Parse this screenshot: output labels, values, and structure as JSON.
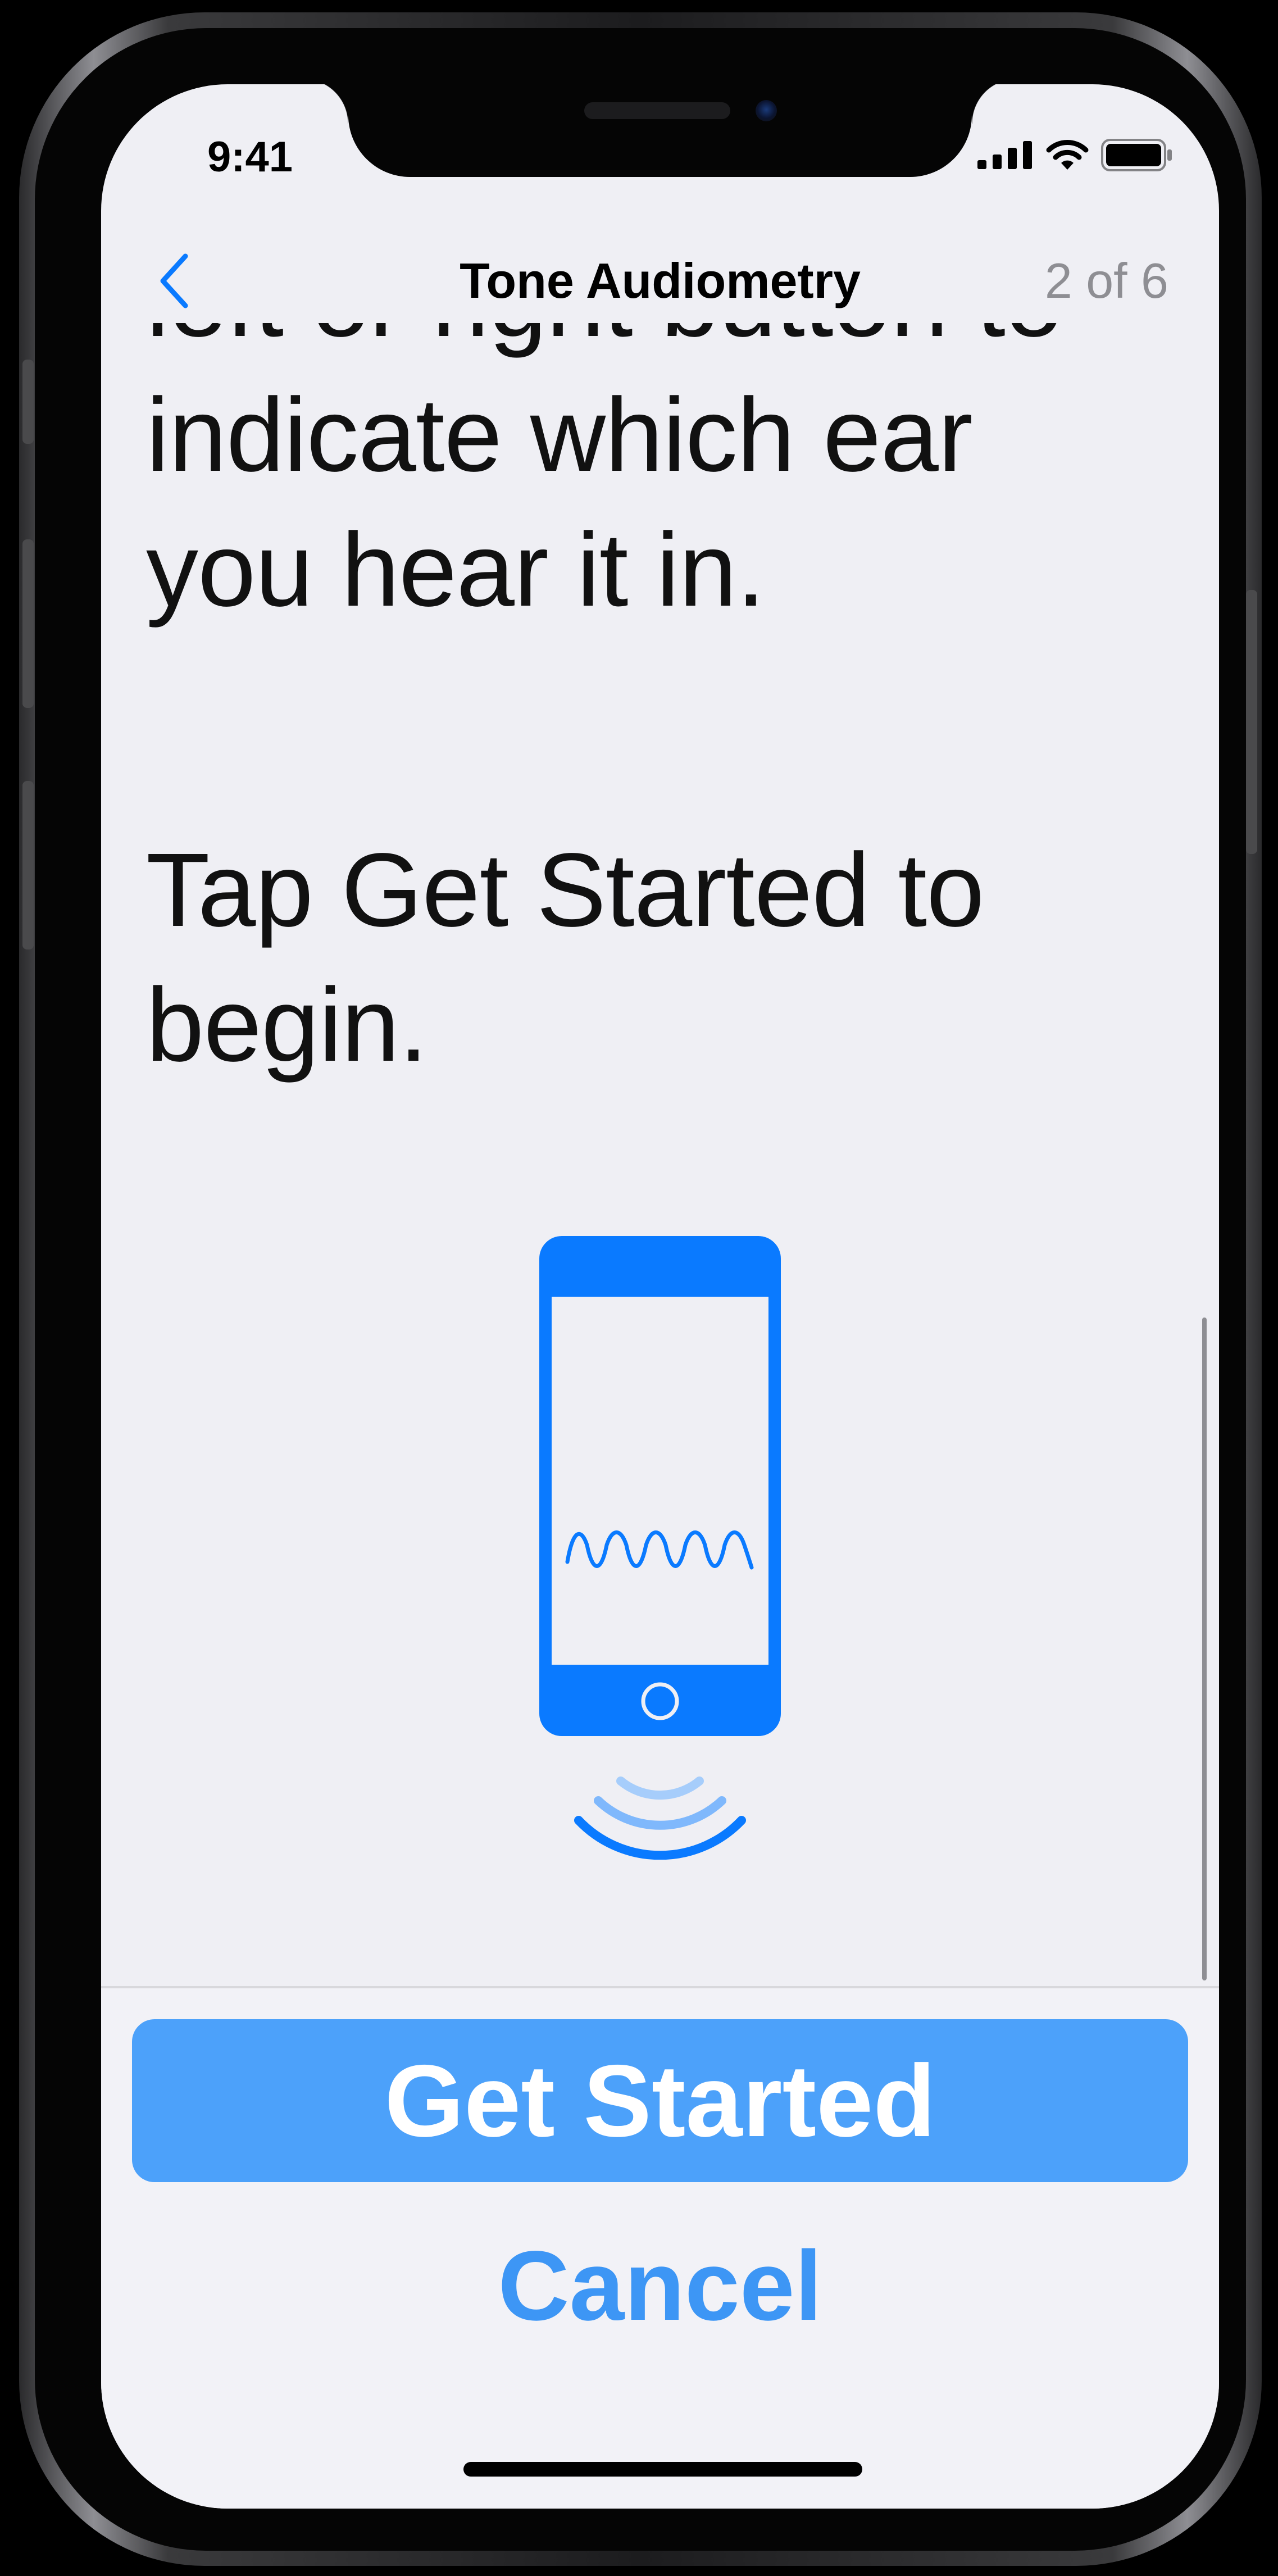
{
  "status_bar": {
    "time": "9:41",
    "icons": [
      "cellular-signal-icon",
      "wifi-icon",
      "battery-icon"
    ]
  },
  "nav": {
    "back_icon": "chevron-left-icon",
    "title": "Tone Audiometry",
    "step": "2 of 6"
  },
  "content": {
    "paragraph_1": "left or right button to indicate which ear you hear it in.",
    "paragraph_2": "Tap Get Started to begin."
  },
  "illustration": {
    "icon": "phone-sound-wave-icon",
    "color": "#0a7aff"
  },
  "actions": {
    "primary_label": "Get Started",
    "cancel_label": "Cancel"
  },
  "colors": {
    "accent": "#0a7aff",
    "primary_button_bg": "#4ca1fa",
    "screen_bg": "#efeff4",
    "secondary_text": "#8e8e93"
  }
}
